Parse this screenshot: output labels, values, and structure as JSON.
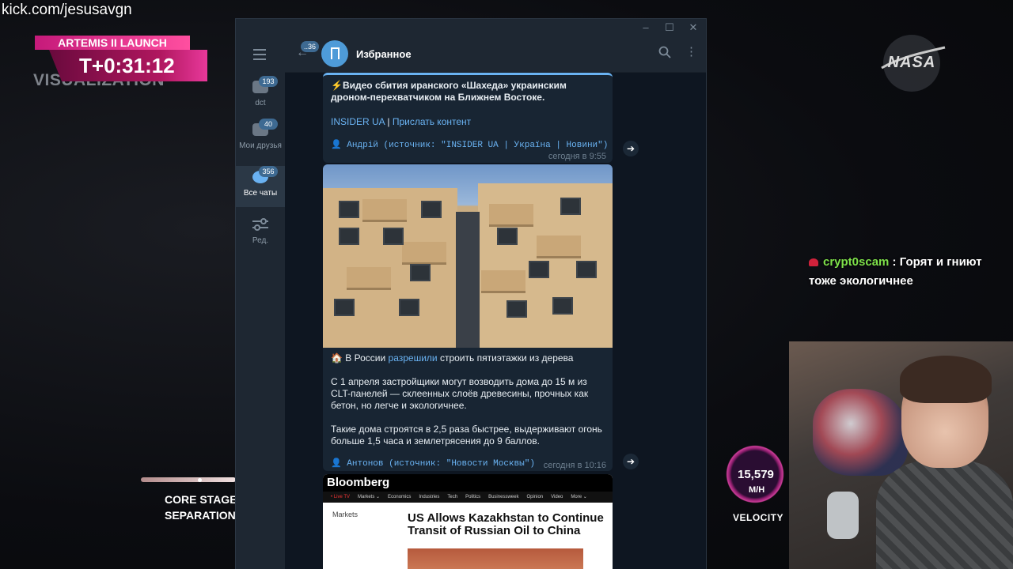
{
  "overlay": {
    "stream_url": "kick.com/jesusavgn",
    "launch_title": "ARTEMIS II LAUNCH",
    "timer": "T+0:31:12",
    "visualization": "VISUALIZATION",
    "nasa_logo": "NASA",
    "chat": {
      "user": "crypt0scam",
      "message": "Горят и гниют тоже экологичнее"
    },
    "stage": {
      "line1": "CORE STAGE",
      "line2": "SEPARATION"
    },
    "velocity": {
      "value": "15,579",
      "unit": "M/H",
      "label": "VELOCITY"
    },
    "colors": {
      "accent_pink": "#c51a7a",
      "chat_user": "#7ee14a"
    }
  },
  "telegram": {
    "window_buttons": [
      "–",
      "☐",
      "✕"
    ],
    "folders": [
      {
        "label": "dct",
        "badge": "193",
        "icon": "chat-icon"
      },
      {
        "label": "Мои друзья",
        "badge": "40",
        "icon": "chat-icon"
      },
      {
        "label": "Все чаты",
        "badge": "356",
        "icon": "chats-icon",
        "active": true
      },
      {
        "label": "Ред.",
        "badge": "",
        "icon": "sliders-icon"
      }
    ],
    "header": {
      "back_badge": "..36",
      "title": "Избранное"
    },
    "messages": [
      {
        "text": "⚡️Видео сбития иранского «Шахеда» украинским дроном-перехватчиком на Ближнем Востоке.",
        "link1": "INSIDER UA",
        "sep": " | ",
        "link2": "Прислать контент",
        "signature": "👤 Андрій (источник: \"INSIDER UA | Україна | Новини\")",
        "time": "сегодня в 9:55"
      },
      {
        "title_prefix": "🏠 В России ",
        "title_link": "разрешили",
        "title_suffix": " строить пятиэтажки из дерева",
        "para1": "С 1 апреля застройщики могут возводить дома до 15 м из CLT-панелей — склеенных слоёв древесины, прочных как бетон, но легче и экологичнее.",
        "para2": "Такие дома строятся в 2,5 раза быстрее, выдерживают огонь больше 1,5 часа и землетрясения до 9 баллов.",
        "signature": "👤 Антонов (источник: \"Новости Москвы\")",
        "time": "сегодня в 10:16"
      }
    ],
    "bloomberg": {
      "brand": "Bloomberg",
      "nav": [
        "• Live TV",
        "Markets ⌄",
        "Economics",
        "Industries",
        "Tech",
        "Politics",
        "Businessweek",
        "Opinion",
        "Video",
        "More ⌄"
      ],
      "section": "Markets",
      "headline": "US Allows Kazakhstan to Continue Transit of Russian Oil to China"
    }
  }
}
